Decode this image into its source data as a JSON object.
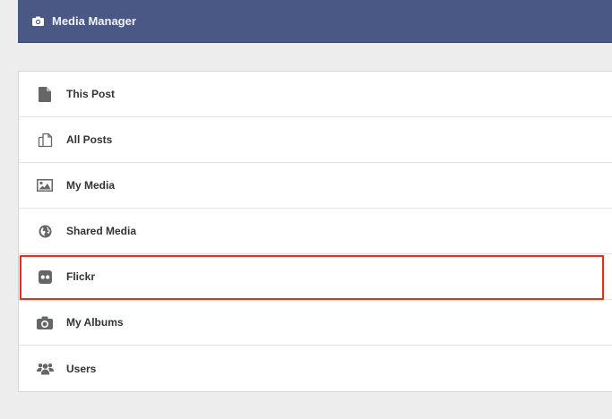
{
  "header": {
    "title": "Media Manager",
    "icon": "camera-icon",
    "background": "#4a5885"
  },
  "sources": [
    {
      "label": "This Post",
      "icon": "file-icon"
    },
    {
      "label": "All Posts",
      "icon": "copy-icon"
    },
    {
      "label": "My Media",
      "icon": "image-icon"
    },
    {
      "label": "Shared Media",
      "icon": "globe-icon"
    },
    {
      "label": "Flickr",
      "icon": "flickr-icon"
    },
    {
      "label": "My Albums",
      "icon": "camera-icon"
    },
    {
      "label": "Users",
      "icon": "users-icon"
    }
  ],
  "highlight": {
    "color": "#e0301e",
    "target": "Flickr"
  },
  "colors": {
    "icon": "#666666",
    "text": "#333333",
    "page_background": "#ededed"
  }
}
